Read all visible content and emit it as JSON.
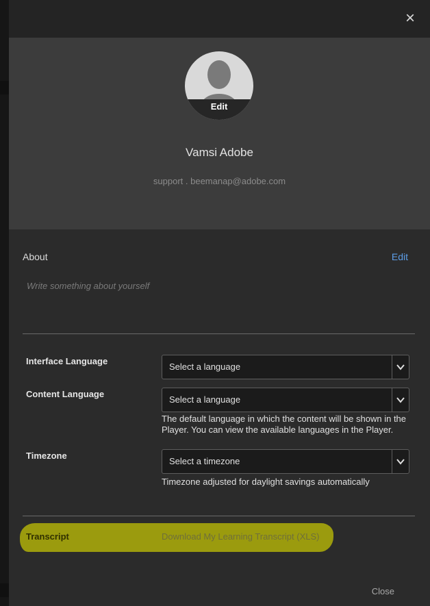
{
  "window": {
    "close_symbol": "×"
  },
  "profile": {
    "avatar_edit_label": "Edit",
    "name": "Vamsi Adobe",
    "email": "support . beemanap@adobe.com"
  },
  "about": {
    "label": "About",
    "edit_label": "Edit",
    "placeholder": "Write something about yourself"
  },
  "settings": {
    "interface_language": {
      "label": "Interface Language",
      "value": "Select a language"
    },
    "content_language": {
      "label": "Content Language",
      "value": "Select a language",
      "help_text": "The default language in which the content will be shown in the Player. You can view the available languages in the Player."
    },
    "timezone": {
      "label": "Timezone",
      "value": "Select a timezone",
      "help_text": "Timezone adjusted for daylight savings automatically"
    }
  },
  "transcript": {
    "label": "Transcript",
    "link_text": "Download My Learning Transcript (XLS)"
  },
  "footer": {
    "close_label": "Close"
  },
  "icons": {
    "close": "close-icon",
    "avatar": "user-silhouette-icon",
    "dropdown": "chevron-down-icon"
  },
  "colors": {
    "link": "#5d9ee8",
    "highlight": "#9b9b0e",
    "modal_bg": "#2b2b2b",
    "hero_bg": "#3c3c3c"
  }
}
